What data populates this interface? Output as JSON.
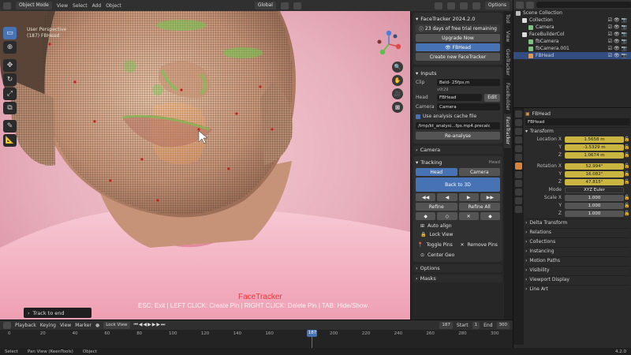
{
  "header": {
    "mode": "Object Mode",
    "menus": [
      "View",
      "Select",
      "Add",
      "Object"
    ],
    "orientation": "Global",
    "options": "Options"
  },
  "viewport": {
    "info_lines": [
      "User Perspective",
      "(187) FBHead"
    ],
    "overlay_title": "FaceTracker",
    "overlay_hint": "ESC: Exit | LEFT CLICK: Create Pin | RIGHT CLICK: Delete Pin | TAB: Hide/Show",
    "track_end_label": "Track to end",
    "tool_icons": [
      "select-box-icon",
      "cursor-icon",
      "move-icon",
      "rotate-icon",
      "scale-icon",
      "transform-icon",
      "annotate-icon",
      "measure-icon"
    ],
    "nav_buttons": [
      "zoom-icon",
      "pan-icon",
      "camera-view-icon",
      "perspective-icon"
    ]
  },
  "npanel": {
    "title": "FaceTracker 2024.2.0",
    "trial_text": "23 days of free trial remaining",
    "upgrade_label": "Upgrade Now",
    "head_item": "FBHead",
    "create_label": "Create new FaceTracker",
    "inputs_label": "Inputs",
    "clip_label": "Clip",
    "clip_value": "Beld- 25fps.m",
    "clip_sub": "v0t29",
    "head_label": "Head",
    "head_value": "FBHead",
    "edit_label": "Edit",
    "camera_label": "Camera",
    "camera_value": "Camera",
    "cache_label": "Use analysis cache file",
    "cache_value": "/tmp/kt_analysi...fps.mp4.precalc",
    "reanalyse_label": "Re-analyse",
    "camera_section": "Camera",
    "tracking_section": "Tracking",
    "tracking_sub": "Head",
    "mode_head": "Head",
    "mode_camera": "Camera",
    "back_to_3d": "Back to 3D",
    "refine": "Refine",
    "refine_all": "Refine All",
    "auto_align": "Auto align",
    "lock_view": "Lock View",
    "toggle_pins": "Toggle Pins",
    "remove_pins": "Remove Pins",
    "center_geo": "Center Geo",
    "options_section": "Options",
    "masks_section": "Masks",
    "side_tabs": [
      "Tool",
      "View",
      "GeoTracker",
      "FaceBuilder",
      "FaceTracker"
    ]
  },
  "outliner": {
    "rows": [
      {
        "name": "Scene Collection",
        "indent": 0,
        "icon": "scene-icon",
        "color": "#bbbbbb",
        "selected": false
      },
      {
        "name": "Collection",
        "indent": 1,
        "icon": "collection-icon",
        "color": "#dddddd",
        "selected": false
      },
      {
        "name": "Camera",
        "indent": 2,
        "icon": "camera-icon",
        "color": "#7ec27e",
        "selected": false
      },
      {
        "name": "FaceBuilderCol",
        "indent": 1,
        "icon": "collection-icon",
        "color": "#dddddd",
        "selected": false
      },
      {
        "name": "fbCamera",
        "indent": 2,
        "icon": "camera-icon",
        "color": "#7ec27e",
        "selected": false
      },
      {
        "name": "fbCamera.001",
        "indent": 2,
        "icon": "camera-icon",
        "color": "#7ec27e",
        "selected": false
      },
      {
        "name": "FBHead",
        "indent": 2,
        "icon": "mesh-icon",
        "color": "#e09a50",
        "selected": true
      }
    ]
  },
  "properties": {
    "object_name": "FBHead",
    "data_name": "FBHead",
    "transform_label": "Transform",
    "location": [
      {
        "axis": "Location X",
        "value": "1.5658 m"
      },
      {
        "axis": "Y",
        "value": "-1.5329 m"
      },
      {
        "axis": "Z",
        "value": "1.0674 m"
      }
    ],
    "rotation": [
      {
        "axis": "Rotation X",
        "value": "52.994°"
      },
      {
        "axis": "Y",
        "value": "16.082°"
      },
      {
        "axis": "Z",
        "value": "47.815°"
      }
    ],
    "mode_label": "Mode",
    "mode_value": "XYZ Euler",
    "scale": [
      {
        "axis": "Scale X",
        "value": "1.000"
      },
      {
        "axis": "Y",
        "value": "1.000"
      },
      {
        "axis": "Z",
        "value": "1.000"
      }
    ],
    "delta_label": "Delta Transform",
    "sections": [
      "Relations",
      "Collections",
      "Instancing",
      "Motion Paths",
      "Visibility",
      "Viewport Display",
      "Line Art"
    ]
  },
  "timeline": {
    "menus": [
      "Playback",
      "Keying",
      "View",
      "Marker"
    ],
    "lock_view": "Lock View",
    "current_frame": "187",
    "start_label": "Start",
    "start_value": "1",
    "end_label": "End",
    "end_value": "300",
    "ticks": [
      "0",
      "20",
      "40",
      "60",
      "80",
      "100",
      "120",
      "140",
      "160",
      "187",
      "200",
      "220",
      "240",
      "260",
      "280",
      "300"
    ]
  },
  "status": {
    "items": [
      "Select",
      "Pan View (KeenTools)",
      "Object"
    ],
    "version": "4.2.0"
  },
  "colors": {
    "accent_blue": "#4772b3",
    "mesh_wire": "#3d3d2a",
    "selected_wire": "#ff8c1a",
    "pin_green": "#7cd455",
    "red_text": "#ff3030"
  }
}
